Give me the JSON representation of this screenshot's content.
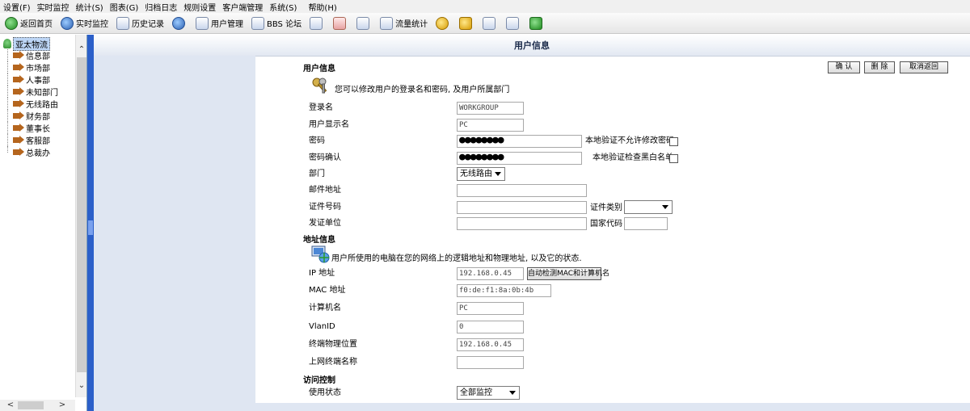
{
  "menu": [
    "设置(F)",
    "实时监控",
    "统计(S)",
    "图表(G)",
    "归档日志",
    "规则设置",
    "客户端管理",
    "系统(S)",
    "帮助(H)"
  ],
  "toolbar": {
    "home": "返回首页",
    "monitor": "实时监控",
    "history": "历史记录",
    "users": "用户管理",
    "bbs": "BBS 论坛",
    "traffic": "流量统计"
  },
  "tree": {
    "root": "亚太物流",
    "items": [
      "信息部",
      "市场部",
      "人事部",
      "未知部门",
      "无线路由",
      "财务部",
      "董事长",
      "客服部",
      "总裁办"
    ]
  },
  "page_title": "用户信息",
  "buttons": {
    "confirm": "确 认",
    "delete": "删 除",
    "cancel": "取消返回"
  },
  "user_section": {
    "title": "用户信息",
    "desc": "您可以修改用户的登录名和密码, 及用户所属部门"
  },
  "fields": {
    "login_label": "登录名",
    "login_value": "WORKGROUP",
    "display_label": "用户显示名",
    "display_value": "PC",
    "password_label": "密码",
    "password_value": "●●●●●●●●",
    "password_note": "本地验证不允许修改密码",
    "confirm_label": "密码确认",
    "confirm_value": "●●●●●●●●",
    "blacklist_note": "本地验证检查黑白名单",
    "dept_label": "部门",
    "dept_value": "无线路由",
    "email_label": "邮件地址",
    "cert_no_label": "证件号码",
    "cert_type_label": "证件类别",
    "issuer_label": "发证单位",
    "country_label": "国家代码"
  },
  "address_section": {
    "title": "地址信息",
    "desc": "用户所使用的电脑在您的网络上的逻辑地址和物理地址, 以及它的状态."
  },
  "address": {
    "ip_label": "IP 地址",
    "ip_value": "192.168.0.45",
    "detect_button": "自动检测MAC和计算机名",
    "mac_label": "MAC 地址",
    "mac_value": "f0:de:f1:8a:0b:4b",
    "host_label": "计算机名",
    "host_value": "PC",
    "vlan_label": "VlanID",
    "vlan_value": "0",
    "location_label": "终端物理位置",
    "location_value": "192.168.0.45",
    "terminal_label": "上网终端名称"
  },
  "access_section": {
    "title": "访问控制"
  },
  "access": {
    "status_label": "使用状态",
    "status_value": "全部监控"
  }
}
